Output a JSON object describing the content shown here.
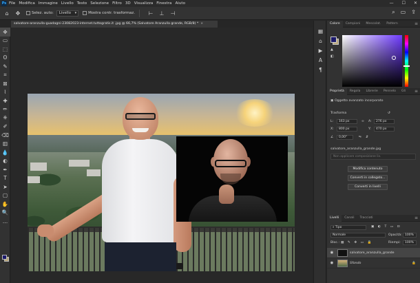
{
  "app": {
    "logo": "Ps"
  },
  "menu": [
    "File",
    "Modifica",
    "Immagine",
    "Livello",
    "Testo",
    "Selezione",
    "Filtro",
    "3D",
    "Visualizza",
    "Finestra",
    "Aiuto"
  ],
  "window_controls": {
    "minimize": "—",
    "maximize": "☐",
    "close": "✕"
  },
  "options_bar": {
    "auto_select_label": "Selez. auto:",
    "auto_select_value": "Livello",
    "show_transform_label": "Mostra contr. trasformaz."
  },
  "document": {
    "tab_title": "salvatore-aranzulla-guadagni-23082023-internet.tuttogratis.it .jpg @ 66,7% (Salvatore Aranzulla grande, RGB/8) *",
    "close": "×"
  },
  "toolbar_icons": [
    "move-icon",
    "artboard-icon",
    "marquee-icon",
    "lasso-icon",
    "quick-select-icon",
    "crop-icon",
    "frame-icon",
    "eyedropper-icon",
    "healing-icon",
    "brush-icon",
    "stamp-icon",
    "history-brush-icon",
    "eraser-icon",
    "gradient-icon",
    "blur-icon",
    "dodge-icon",
    "pen-icon",
    "type-icon",
    "path-select-icon",
    "rectangle-icon",
    "hand-icon",
    "zoom-icon",
    "more-icon"
  ],
  "toolbar_glyphs": [
    "✥",
    "▭",
    "⬚",
    "ʘ",
    "✎",
    "⌗",
    "⊠",
    "⌇",
    "✚",
    "✏",
    "⎈",
    "✐",
    "⌫",
    "▥",
    "💧",
    "◐",
    "✒",
    "T",
    "➤",
    "▢",
    "✋",
    "🔍",
    "…"
  ],
  "icon_column_glyphs": [
    "▦",
    "⌂",
    "▶",
    "A",
    "¶"
  ],
  "color_panel": {
    "tabs": [
      "Colore",
      "Campioni",
      "Mescolat.",
      "Pattern"
    ],
    "active": 0
  },
  "properties_panel": {
    "tabs": [
      "Proprietà",
      "Regola",
      "Librerie",
      "Pennelo",
      "Gli"
    ],
    "active": 0,
    "object_type": "Oggetto avanzato incorporato",
    "transform_label": "Trasforma",
    "L": "L:",
    "L_value": "163 px",
    "A": "A:",
    "A_value": "276 px",
    "X": "X:",
    "X_value": "800 px",
    "Y": "Y:",
    "Y_value": "470 px",
    "angle": "0,00°",
    "filename": "salvatore_aranzulla_grande.jpg",
    "composition": "Non applicare composizione liv.",
    "btn_edit": "Modifica contenuto",
    "btn_convert": "Converti in collegato...",
    "btn_layers": "Converti in livelli"
  },
  "layers_panel": {
    "tabs": [
      "Livelli",
      "Canali",
      "Tracciati"
    ],
    "active": 0,
    "filter": "Tipo",
    "blend": "Normale",
    "opacity_label": "Opacità:",
    "opacity_value": "100%",
    "lock_label": "Bloc.:",
    "fill_label": "Riempi:",
    "fill_value": "100%",
    "layers": [
      {
        "name": "salvatore_aranzulla_grande",
        "selected": true
      },
      {
        "name": "Sfondo",
        "selected": false
      }
    ]
  },
  "colors": {
    "foreground": "#1c1a6b",
    "background": "#b9a678"
  }
}
